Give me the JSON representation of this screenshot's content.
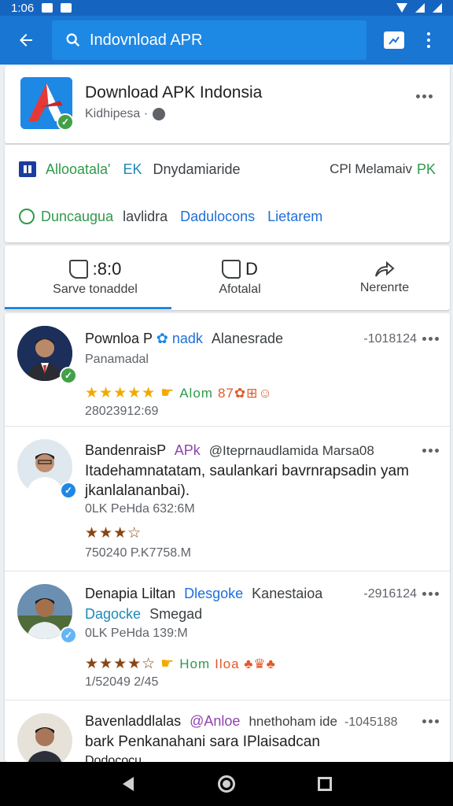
{
  "status": {
    "time": "1:06"
  },
  "search": {
    "query": "Indovnload APR"
  },
  "header": {
    "title": "Download APK Indonsia",
    "subtitle": "Kidhipesa ·"
  },
  "info": {
    "row1": {
      "a": "Allooatala'",
      "b": "EK",
      "c": "Dnydamiaride",
      "d": "CPl Melamaiv",
      "e": "PK"
    },
    "row2": {
      "a": "Duncaugua",
      "b": "lavlidra",
      "c": "Dadulocons",
      "d": "Lietarem"
    }
  },
  "actions": [
    {
      "count": ":8:0",
      "label": "Sarve tonaddel"
    },
    {
      "count": "D",
      "label": "Afotalal"
    },
    {
      "count": "",
      "label": "Nerenrte"
    }
  ],
  "posts": [
    {
      "name": "Pownloa P",
      "tag": "nadk",
      "handle": "Alanesrade",
      "time": "-1018124",
      "line1": "Panamadal",
      "stars": "★★★★★",
      "tag_text": "Alom",
      "emoji": "87✿⊞☺",
      "line2": "28023912:69"
    },
    {
      "name": "BandenraisP",
      "tag": "APk",
      "handle": "@Iteprnaudlamida Marsa08",
      "time": "",
      "body": "Itadehamnatatam, saulankari bavrnrapsadin yam jkanlalananbai).",
      "line1": "0LK PeHda 632:6M",
      "stars": "★★★☆",
      "line2": "750240 P.K7758.M"
    },
    {
      "name": "Denapia Liltan",
      "tag": "Dlesgoke",
      "handle": "Kanestaioa",
      "time": "-2916124",
      "line1": "Dagocke",
      "line1b": "Smegad",
      "line2a": "0LK PeHda 139:M",
      "stars": "★★★★☆",
      "tag_text": "Hom",
      "emoji": "Iloa ♣♛♣",
      "line2": "1/52049 2/45"
    },
    {
      "name": "Bavenladdlalas",
      "tag": "@Anloe",
      "handle": "hnethoham ide",
      "time": "-1045188",
      "body": "bark Penkanahani sara IPlaisadcan",
      "line1": "Dodococu"
    }
  ],
  "colors": {
    "primary": "#1976d2",
    "status_bar": "#1565c0",
    "verified": "#43a047",
    "star": "#f2a900"
  }
}
